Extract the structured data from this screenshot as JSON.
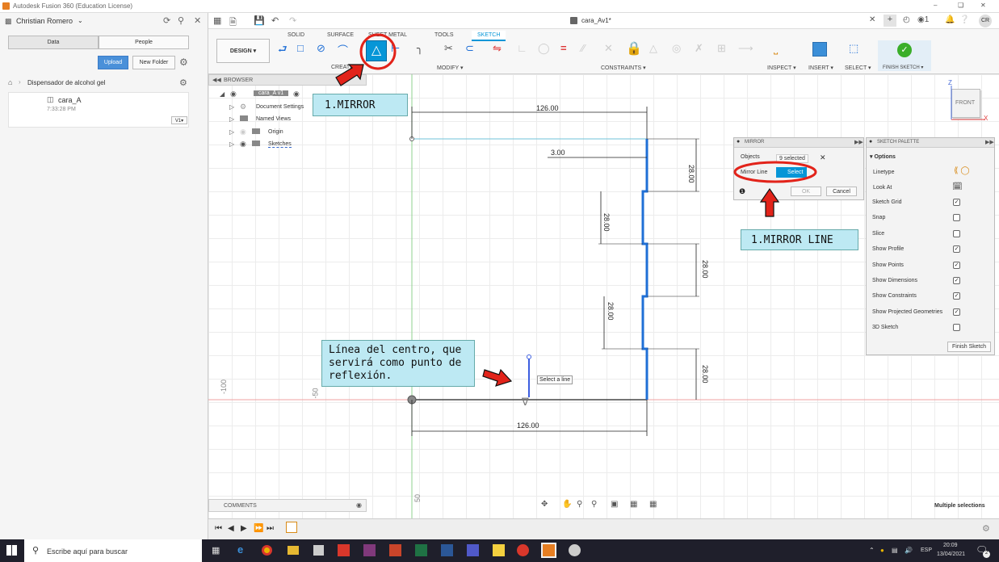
{
  "window": {
    "title": "Autodesk Fusion 360 (Education License)",
    "doc_title": "cara_Av1*",
    "user_initials": "CR"
  },
  "account": {
    "user": "Christian Romero"
  },
  "data_panel": {
    "tabs": [
      "Data",
      "People"
    ],
    "upload": "Upload",
    "new_folder": "New Folder",
    "project": "Dispensador de alcohol gel",
    "item": {
      "name": "cara_A",
      "time": "7:33:28 PM",
      "version": "V1▾"
    }
  },
  "ribbon": {
    "workspace": "DESIGN ▾",
    "tabs": [
      "SOLID",
      "SURFACE",
      "SHEET METAL",
      "TOOLS",
      "SKETCH"
    ],
    "active_tab": "SKETCH",
    "groups": [
      "CREATE",
      "MODIFY ▾",
      "CONSTRAINTS ▾",
      "INSPECT ▾",
      "INSERT ▾",
      "SELECT ▾",
      "FINISH SKETCH ▾"
    ]
  },
  "browser": {
    "header": "BROWSER",
    "root": "cara_A v1",
    "items": [
      "Document Settings",
      "Named Views",
      "Origin",
      "Sketches"
    ]
  },
  "mirror_dialog": {
    "title": "MIRROR",
    "objects_label": "Objects",
    "objects_value": "9 selected",
    "mirror_line_label": "Mirror Line",
    "mirror_line_value": "Select",
    "ok": "OK",
    "cancel": "Cancel"
  },
  "sketch_palette": {
    "title": "SKETCH PALETTE",
    "section": "▾ Options",
    "linetype": "Linetype",
    "look_at": "Look At",
    "options": [
      {
        "label": "Sketch Grid",
        "checked": true
      },
      {
        "label": "Snap",
        "checked": false
      },
      {
        "label": "Slice",
        "checked": false
      },
      {
        "label": "Show Profile",
        "checked": true
      },
      {
        "label": "Show Points",
        "checked": true
      },
      {
        "label": "Show Dimensions",
        "checked": true
      },
      {
        "label": "Show Constraints",
        "checked": true
      },
      {
        "label": "Show Projected Geometries",
        "checked": true
      },
      {
        "label": "3D Sketch",
        "checked": false
      }
    ],
    "finish": "Finish Sketch"
  },
  "viewcube": {
    "face": "FRONT",
    "z": "Z",
    "x": "X"
  },
  "dimensions": {
    "top": "126.00",
    "bottom": "126.00",
    "small": "3.00",
    "d28": "28.00",
    "ruler_left": "-100",
    "ruler_mid": "-50",
    "ruler_bottom": "50"
  },
  "tooltip": "Select a line",
  "callouts": {
    "mirror": "1.MIRROR",
    "mirror_line": "1.MIRROR LINE",
    "center": "Línea del centro, que servirá como punto de reflexión."
  },
  "status": {
    "comments": "COMMENTS",
    "selection": "Multiple selections"
  },
  "taskbar": {
    "search": "Escribe aquí para buscar",
    "lang": "ESP",
    "time": "20:09",
    "date": "13/04/2021",
    "notif": "2"
  },
  "colors": {
    "accent": "#0696d7",
    "sketch_line": "#1f6fd6",
    "callout_bg": "#bde9f3",
    "highlight": "#e2231a",
    "ok_green": "#3aae2a"
  }
}
